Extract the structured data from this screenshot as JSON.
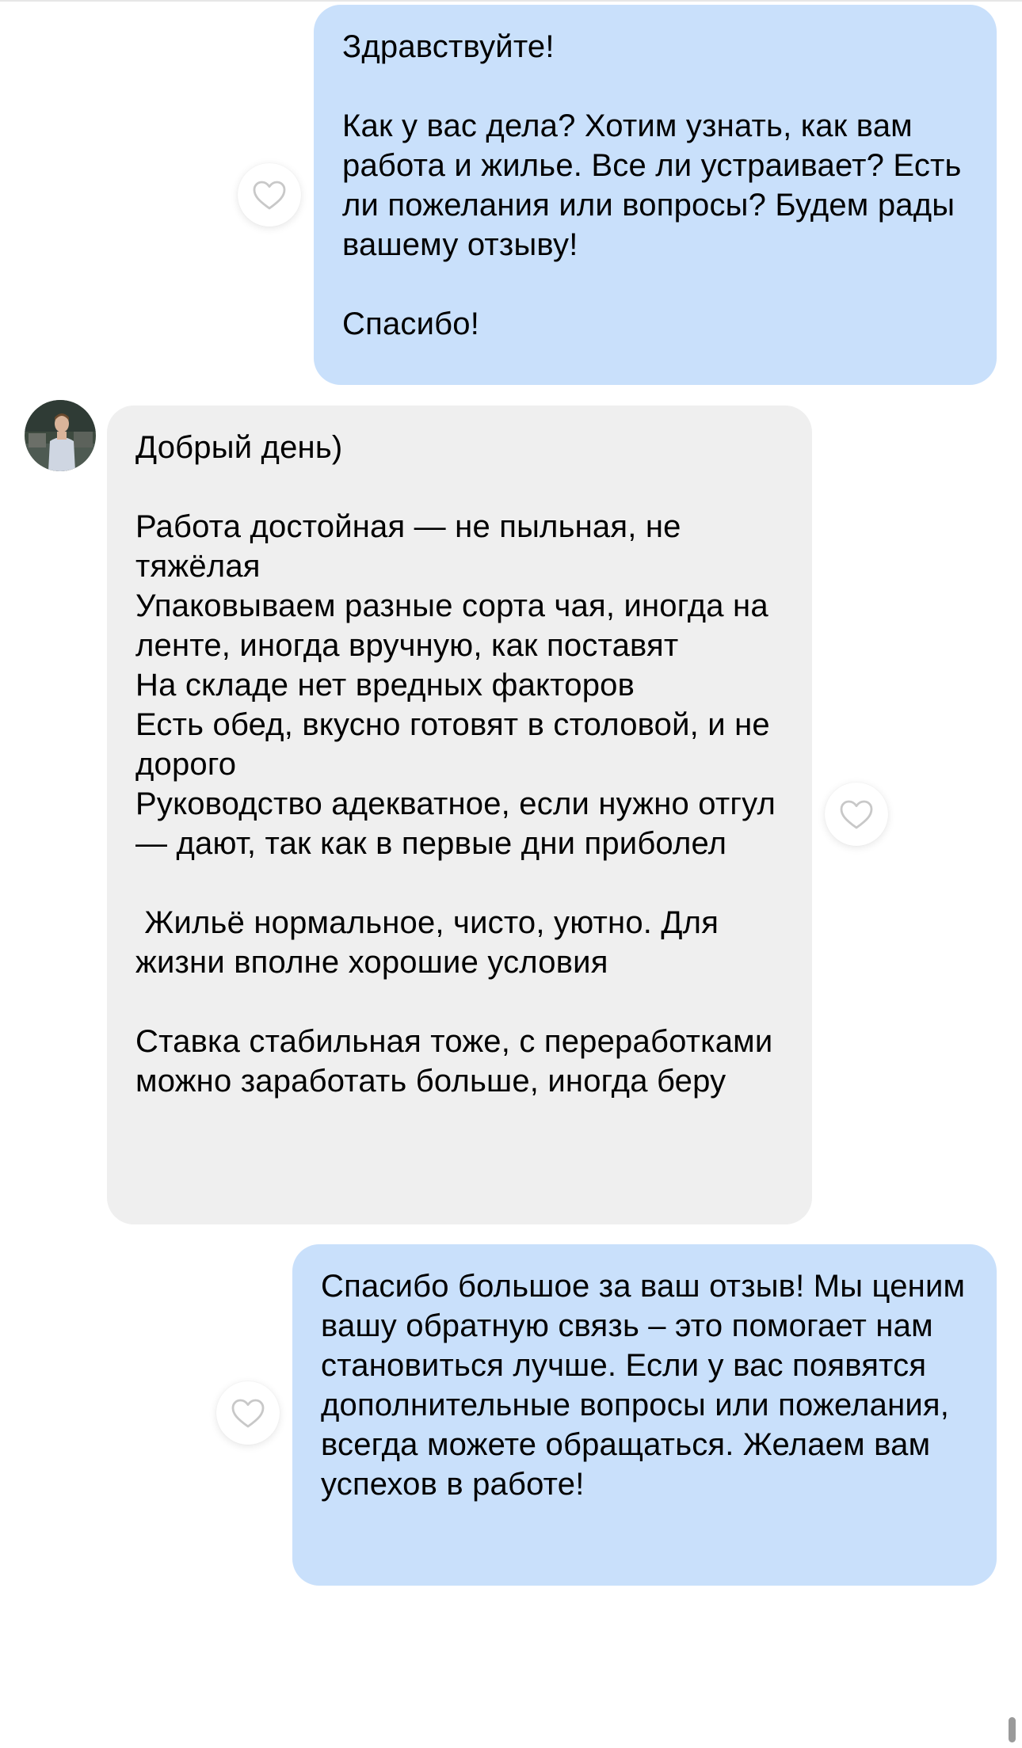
{
  "messages": [
    {
      "direction": "outgoing",
      "text": "Здравствуйте!\n\nКак у вас дела? Хотим узнать, как вам работа и жилье. Все ли устраивает? Есть ли пожелания или вопросы? Будем рады вашему отзыву!\n\nСпасибо!"
    },
    {
      "direction": "incoming",
      "text": "Добрый день)\n\nРабота достойная — не пыльная, не тяжёлая\nУпаковываем разные сорта чая, иногда на ленте, иногда вручную, как поставят\nНа складе нет вредных факторов\nЕсть обед, вкусно готовят в столовой, и не дорого\nРуководство адекватное, если нужно отгул — дают, так как в первые дни приболел\n\n Жильё нормальное, чисто, уютно. Для жизни вполне хорошие условия\n\nСтавка стабильная тоже, с переработками можно заработать больше, иногда беру"
    },
    {
      "direction": "outgoing",
      "text": "Спасибо большое за ваш отзыв! Мы ценим вашу обратную связь – это помогает нам становиться лучше. Если у вас появятся дополнительные вопросы или пожелания, всегда можете обращаться. Желаем вам успехов в работе!"
    }
  ],
  "icons": {
    "like": "heart-outline-icon",
    "avatar": "user-avatar"
  },
  "colors": {
    "outgoing_bubble": "#c9e0fb",
    "incoming_bubble": "#efefef",
    "heart_stroke": "#c8c8c8"
  }
}
